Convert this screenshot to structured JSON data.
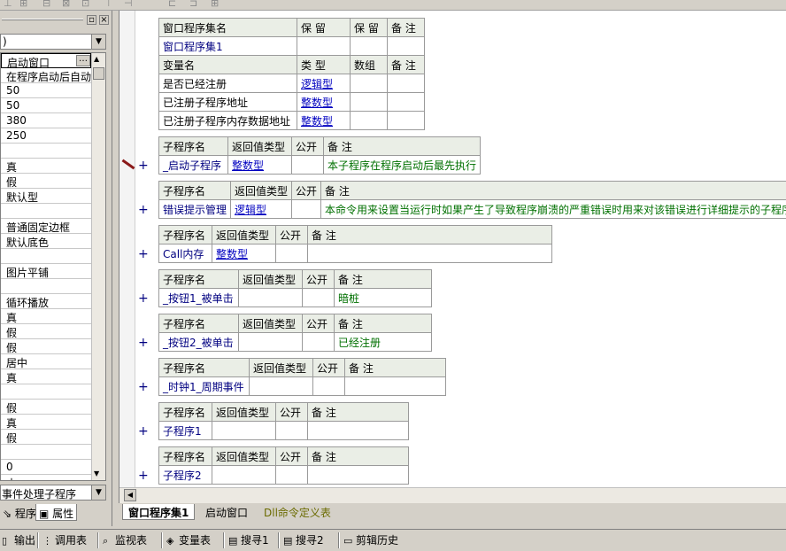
{
  "left_panel": {
    "combo_value": ")",
    "properties": [
      "启动窗口",
      "在程序启动后自动",
      "50",
      "50",
      "380",
      "250",
      "",
      "真",
      "假",
      "默认型",
      "",
      "普通固定边框",
      "默认底色",
      "",
      "图片平铺",
      "",
      "循环播放",
      "真",
      "假",
      "假",
      "居中",
      "真",
      "",
      "假",
      "真",
      "假",
      "",
      "0",
      "古"
    ],
    "event_combo": "事件处理子程序",
    "tabs": {
      "program": "程序",
      "properties": "属性"
    }
  },
  "assembly": {
    "headers": [
      "窗口程序集名",
      "保 留",
      "保 留",
      "备 注"
    ],
    "name": "窗口程序集1",
    "var_headers": [
      "变量名",
      "类 型",
      "数组",
      "备 注"
    ],
    "vars": [
      {
        "name": "是否已经注册",
        "type": "逻辑型"
      },
      {
        "name": "已注册子程序地址",
        "type": "整数型"
      },
      {
        "name": "已注册子程序内存数据地址",
        "type": "整数型"
      }
    ]
  },
  "subs": [
    {
      "headers": [
        "子程序名",
        "返回值类型",
        "公开",
        "备 注"
      ],
      "name": "_启动子程序",
      "ret": "整数型",
      "remark": "本子程序在程序启动后最先执行"
    },
    {
      "headers": [
        "子程序名",
        "返回值类型",
        "公开",
        "备 注"
      ],
      "name": "错误提示管理",
      "ret": "逻辑型",
      "remark": "本命令用来设置当运行时如果产生了导致程序崩溃的严重错误时用来对该错误进行详细提示的子程序"
    },
    {
      "headers": [
        "子程序名",
        "返回值类型",
        "公开",
        "备 注"
      ],
      "name": "Call内存",
      "ret": "整数型",
      "remark": ""
    },
    {
      "headers": [
        "子程序名",
        "返回值类型",
        "公开",
        "备 注"
      ],
      "name": "_按钮1_被单击",
      "ret": "",
      "remark": "暗桩"
    },
    {
      "headers": [
        "子程序名",
        "返回值类型",
        "公开",
        "备 注"
      ],
      "name": "_按钮2_被单击",
      "ret": "",
      "remark": "已经注册"
    },
    {
      "headers": [
        "子程序名",
        "返回值类型",
        "公开",
        "备 注"
      ],
      "name": "_时钟1_周期事件",
      "ret": "",
      "remark": ""
    },
    {
      "headers": [
        "子程序名",
        "返回值类型",
        "公开",
        "备 注"
      ],
      "name": "子程序1",
      "ret": "",
      "remark": ""
    },
    {
      "headers": [
        "子程序名",
        "返回值类型",
        "公开",
        "备 注"
      ],
      "name": "子程序2",
      "ret": "",
      "remark": ""
    }
  ],
  "editor_tabs": [
    "窗口程序集1",
    "启动窗口",
    "Dll命令定义表"
  ],
  "bottom_tabs": [
    "输出",
    "调用表",
    "监视表",
    "变量表",
    "搜寻1",
    "搜寻2",
    "剪辑历史"
  ],
  "plus_glyph": "+",
  "colors": {
    "header_bg": "#eaeee6",
    "link_blue": "#0000c0",
    "remark_green": "#007000"
  }
}
